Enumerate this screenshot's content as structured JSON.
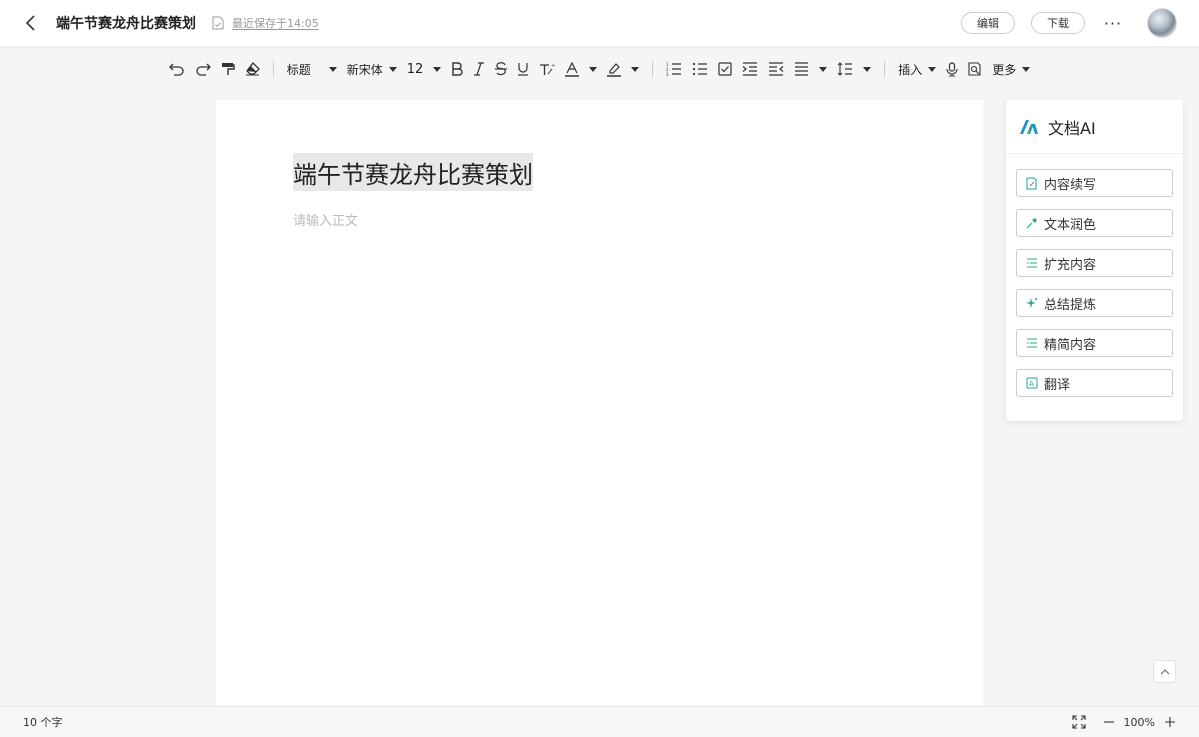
{
  "header": {
    "doc_title": "端午节赛龙舟比赛策划",
    "save_status": "最近保存于14:05",
    "edit_label": "编辑",
    "download_label": "下载",
    "more_label": "···"
  },
  "toolbar": {
    "heading_label": "标题",
    "font_label": "新宋体",
    "size_label": "12",
    "insert_label": "插入",
    "more_label": "更多"
  },
  "document": {
    "title": "端午节赛龙舟比赛策划",
    "body_placeholder": "请输入正文"
  },
  "ai_panel": {
    "title": "文档AI",
    "actions": [
      {
        "label": "内容续写",
        "icon": "edit-doc-icon"
      },
      {
        "label": "文本润色",
        "icon": "brush-icon"
      },
      {
        "label": "扩充内容",
        "icon": "expand-lines-icon"
      },
      {
        "label": "总结提炼",
        "icon": "sparkle-icon"
      },
      {
        "label": "精简内容",
        "icon": "condense-lines-icon"
      },
      {
        "label": "翻译",
        "icon": "translate-icon"
      }
    ],
    "accent_color": "#2aa58e"
  },
  "statusbar": {
    "word_count": "10  个字",
    "zoom": "100%"
  }
}
